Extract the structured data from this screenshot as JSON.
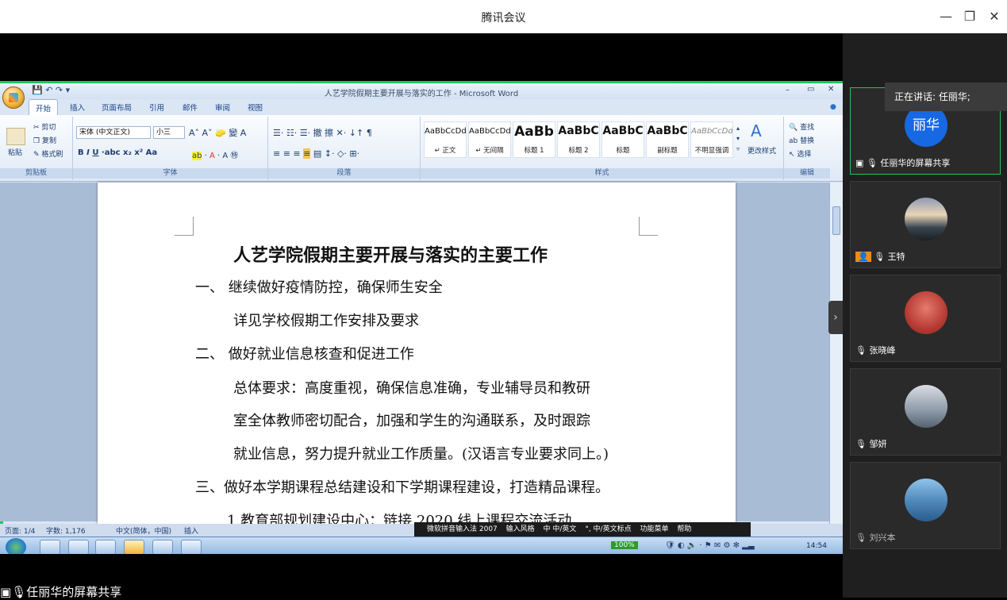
{
  "app": {
    "title": "腾讯会议"
  },
  "word": {
    "window_title": "人艺学院假期主要开展与落实的工作 - Microsoft Word",
    "tabs": [
      "开始",
      "插入",
      "页面布局",
      "引用",
      "邮件",
      "审阅",
      "视图"
    ],
    "clipboard": {
      "paste": "粘贴",
      "cut": "剪切",
      "copy": "复制",
      "painter": "格式刷",
      "label": "剪贴板"
    },
    "font": {
      "name": "宋体 (中文正文)",
      "size": "小三",
      "label": "字体"
    },
    "paragraph_label": "段落",
    "styles": [
      {
        "sample": "AaBbCcDd",
        "name": "↵ 正文"
      },
      {
        "sample": "AaBbCcDd",
        "name": "↵ 无间隔"
      },
      {
        "sample": "AaBb",
        "name": "标题 1"
      },
      {
        "sample": "AaBbC",
        "name": "标题 2"
      },
      {
        "sample": "AaBbC",
        "name": "标题"
      },
      {
        "sample": "AaBbC",
        "name": "副标题"
      },
      {
        "sample": "AaBbCcDd",
        "name": "不明显强调"
      }
    ],
    "styles_label": "样式",
    "change_styles": "更改样式",
    "editing": {
      "find": "查找",
      "replace": "替换",
      "select": "选择",
      "label": "编辑"
    },
    "document": {
      "title": "人艺学院假期主要开展与落实的主要工作",
      "lines": [
        "一、  继续做好疫情防控，确保师生安全",
        "详见学校假期工作安排及要求",
        "二、  做好就业信息核查和促进工作",
        "总体要求：高度重视，确保信息准确，专业辅导员和教研",
        "室全体教师密切配合，加强和学生的沟通联系，及时跟踪",
        "就业信息，努力提升就业工作质量。(汉语言专业要求同上。)",
        "三、做好本学期课程总结建设和下学期课程建设，打造精品课程。",
        "1.教育部规划建设中心：链接 2020 线上课程交流活动"
      ]
    },
    "status": {
      "page": "页面: 1/4",
      "words": "字数: 1,176",
      "lang": "中文(简体，中国)",
      "mode": "插入"
    },
    "ime": {
      "name": "微软拼音输入法 2007",
      "style": "输入风格",
      "mode": "中 中/英文",
      "punct": "°, 中/英文标点",
      "menu": "功能菜单",
      "help": "帮助"
    },
    "zoom": "100%",
    "clock": "14:54"
  },
  "meeting": {
    "speaking": "正在讲话: 任丽华;",
    "participants": [
      {
        "name": "任丽华的屏幕共享",
        "avatar_text": "丽华",
        "color": "#1668e3"
      },
      {
        "name": "王特"
      },
      {
        "name": "张晓峰"
      },
      {
        "name": "邹妍"
      },
      {
        "name": "刘兴本"
      }
    ],
    "footer": "任丽华的屏幕共享"
  }
}
